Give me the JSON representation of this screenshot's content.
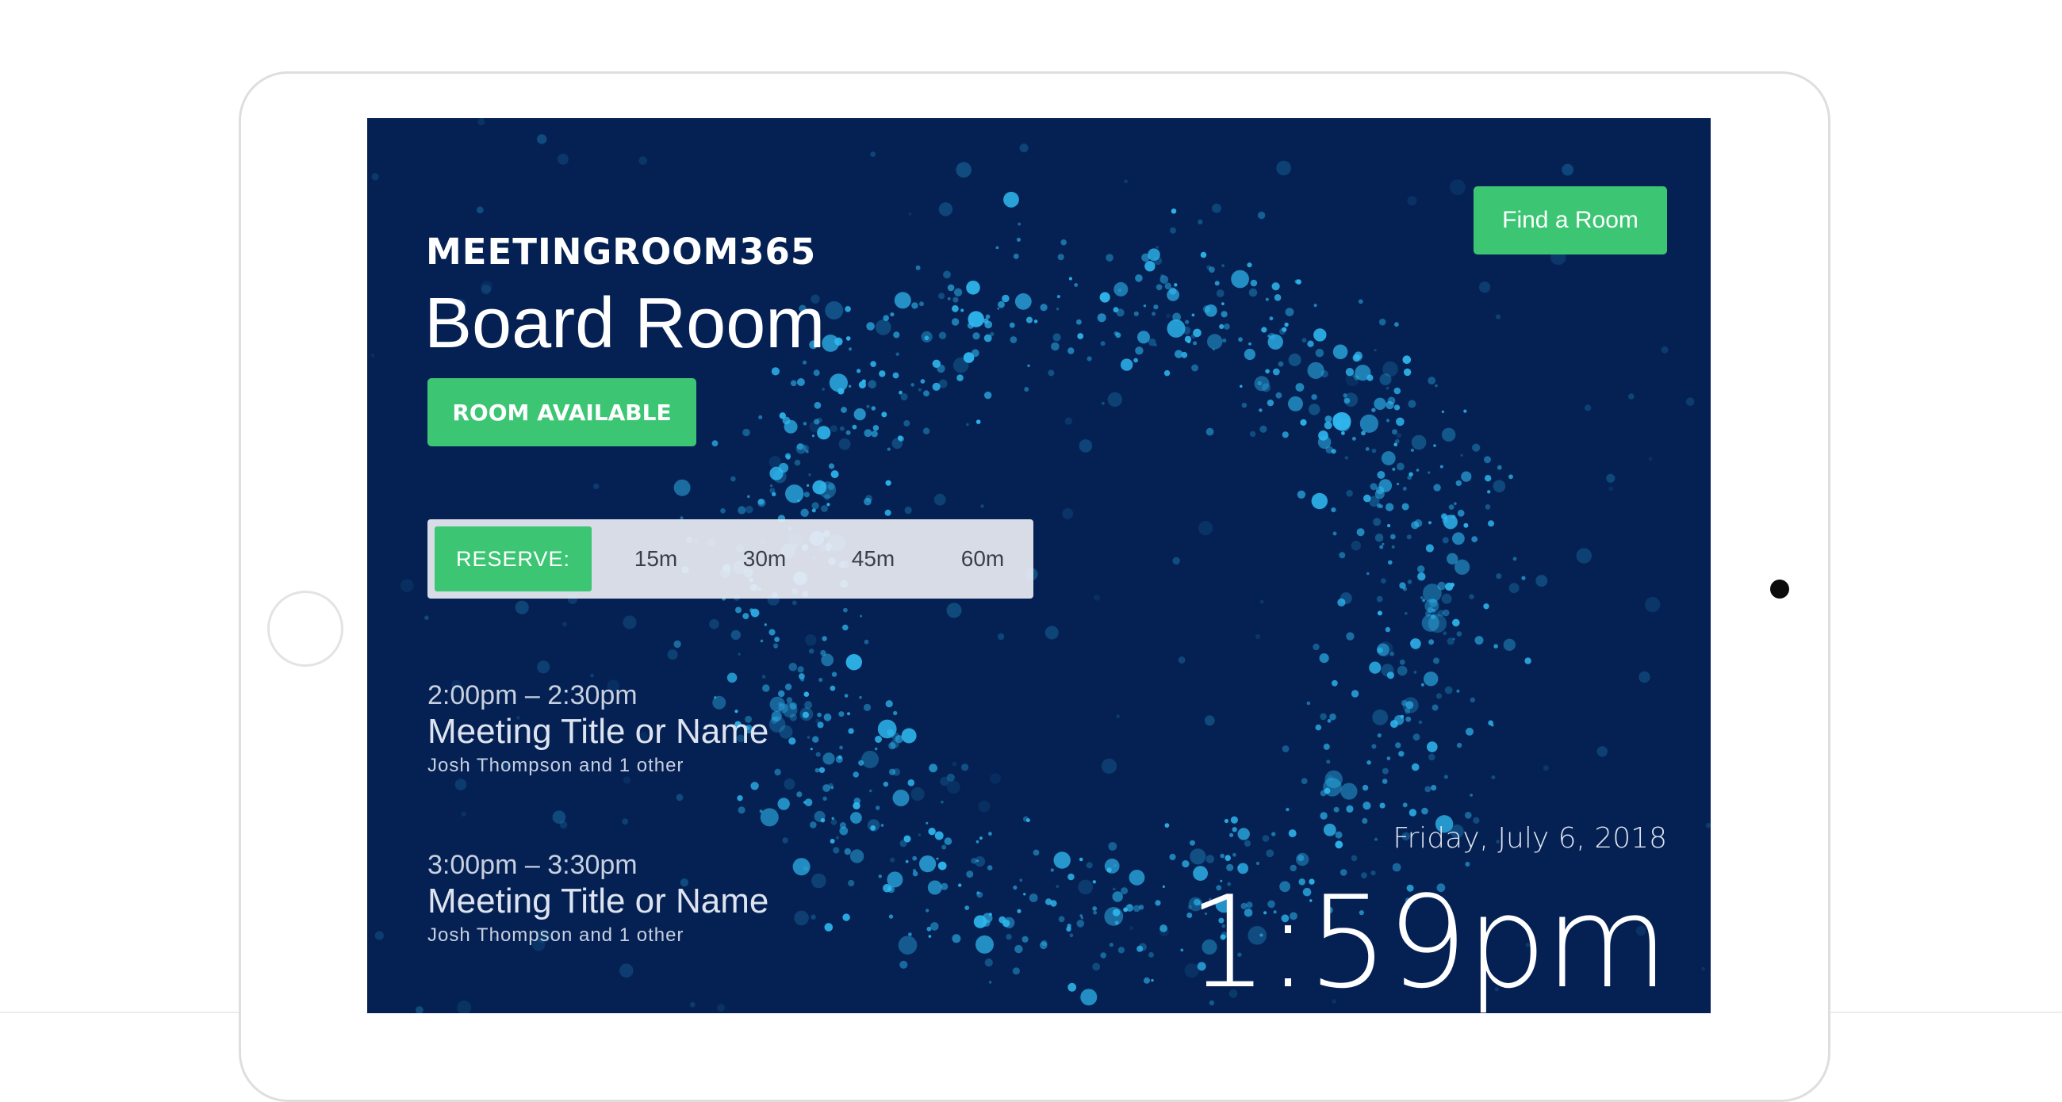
{
  "app": {
    "logo_text": "MEETINGROOM365",
    "room_name": "Board Room",
    "status_label": "ROOM AVAILABLE",
    "find_room_label": "Find a Room"
  },
  "reserve": {
    "label": "RESERVE:",
    "options": [
      "15m",
      "30m",
      "45m",
      "60m"
    ]
  },
  "meetings": [
    {
      "time": "2:00pm – 2:30pm",
      "title": "Meeting Title or Name",
      "attendees": "Josh Thompson and 1 other"
    },
    {
      "time": "3:00pm – 3:30pm",
      "title": "Meeting Title or Name",
      "attendees": "Josh Thompson and 1 other"
    }
  ],
  "clock": {
    "date": "Friday, July 6, 2018",
    "time": "1:59pm"
  },
  "colors": {
    "screen_background": "#052153",
    "accent_green": "#3cc674",
    "particle_blue": "#2fb8ef"
  }
}
